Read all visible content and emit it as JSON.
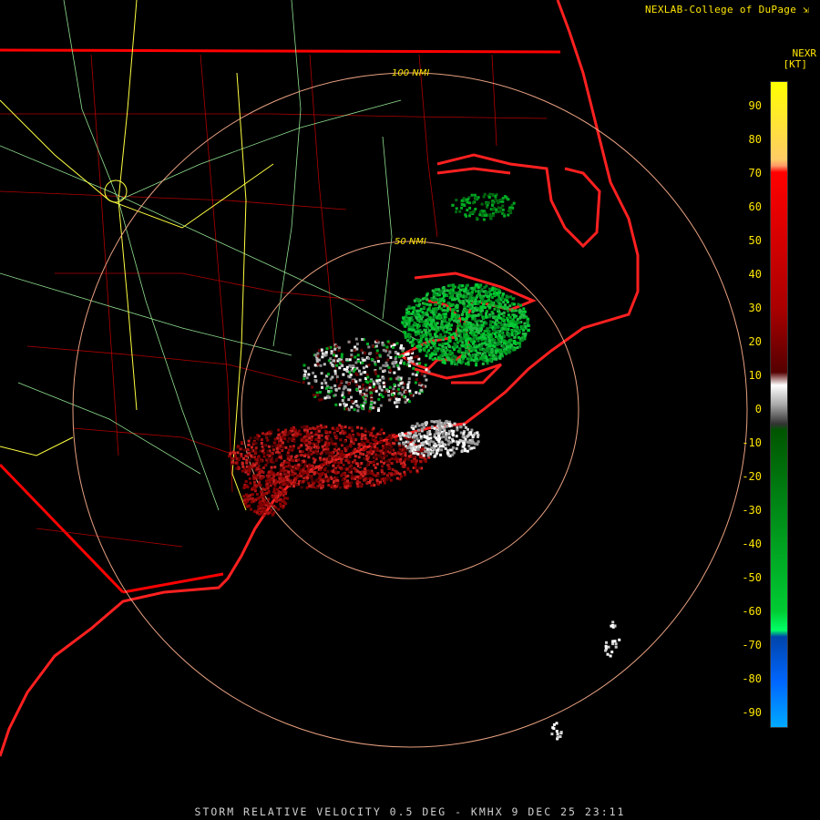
{
  "credit": "NEXLAB-College of DuPage",
  "footer": "STORM RELATIVE VELOCITY 0.5 DEG - KMHX 9 DEC 25 23:11",
  "legend": {
    "title_top": "NEXR",
    "units": "[KT]",
    "ticks": [
      "90",
      "80",
      "70",
      "60",
      "50",
      "40",
      "30",
      "20",
      "10",
      "0",
      "-10",
      "-20",
      "-30",
      "-40",
      "-50",
      "-60",
      "-70",
      "-80",
      "-90"
    ],
    "colors": {
      "high": "#ffff00",
      "mid_red": "#ff0000",
      "dark_red": "#550000",
      "neutral": "#aaaaaa",
      "green": "#00cc33",
      "blue": "#0066ff",
      "light_blue": "#00aaff"
    }
  },
  "range_rings": [
    {
      "label": "100 NMI"
    },
    {
      "label": "50 NMI"
    }
  ]
}
